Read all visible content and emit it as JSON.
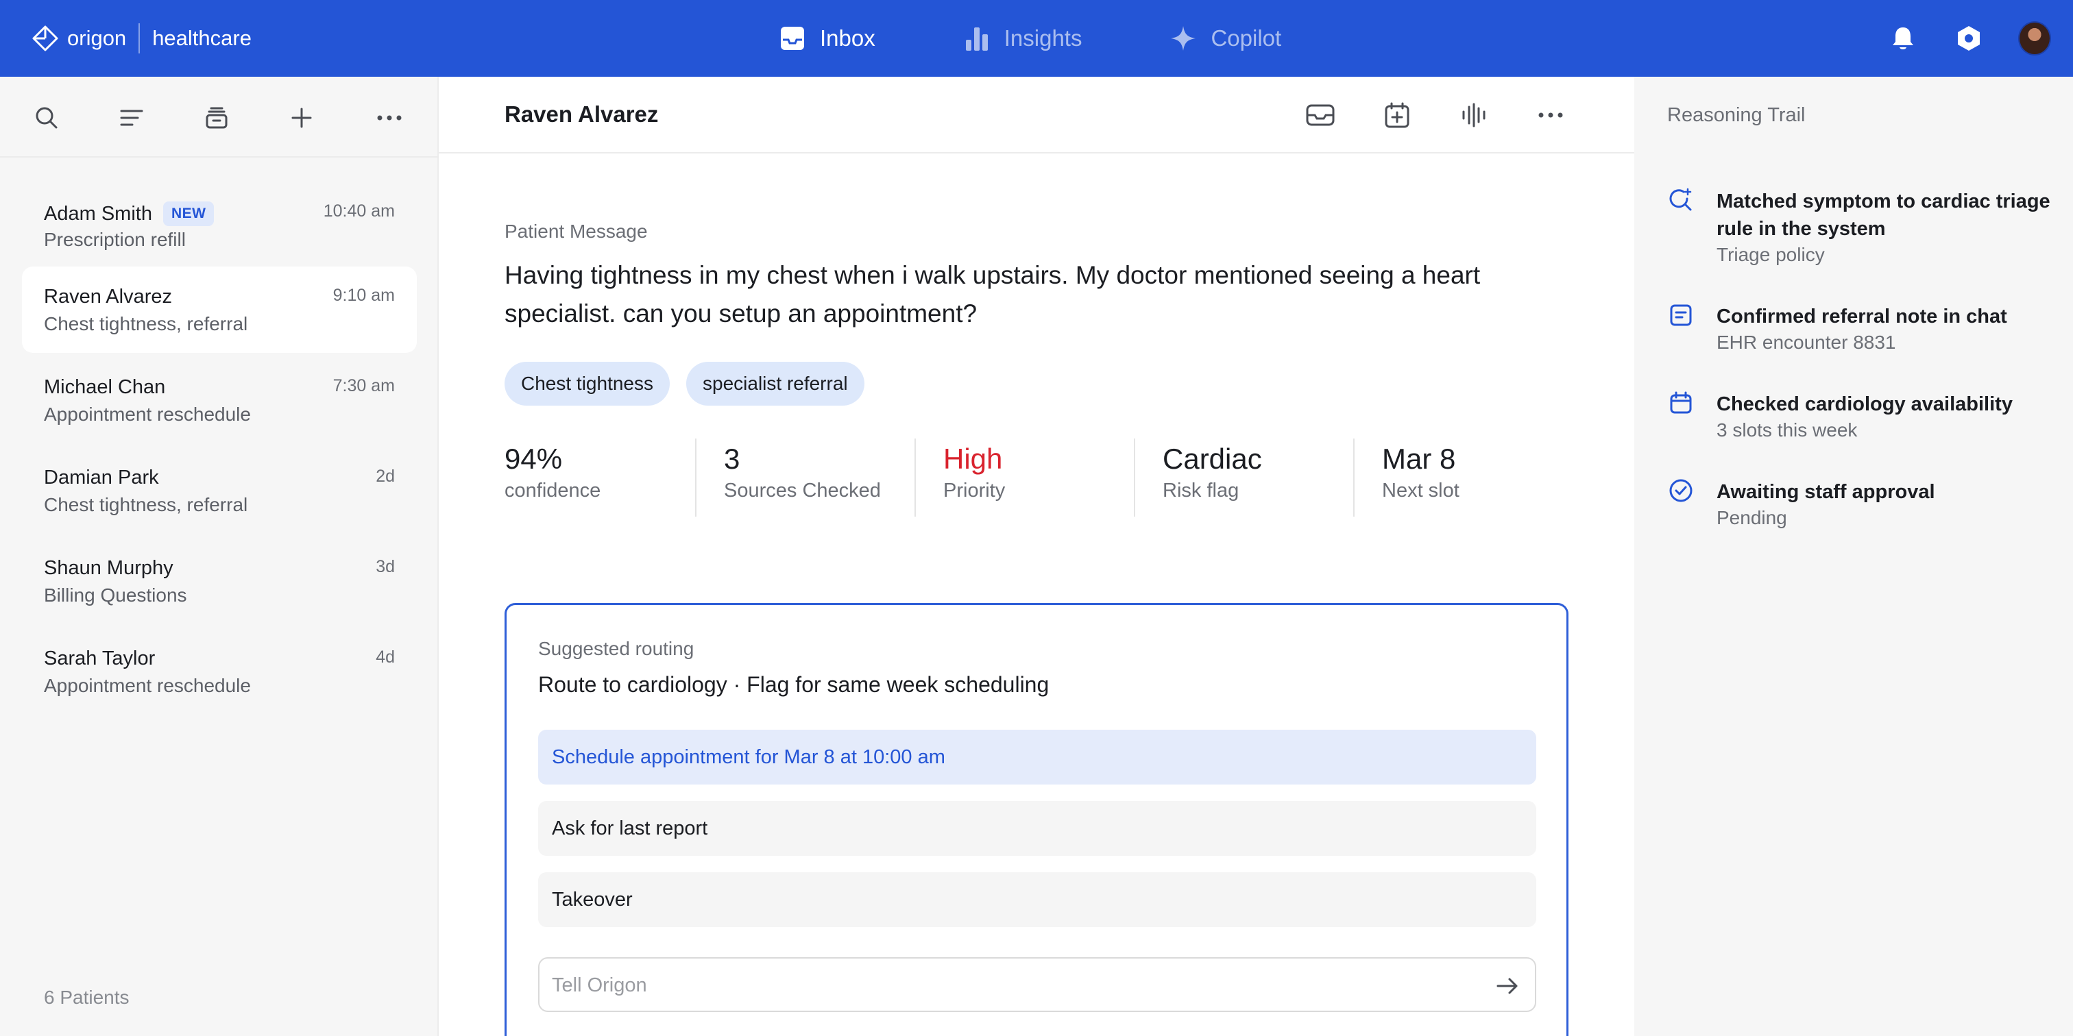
{
  "brand": {
    "name": "origon",
    "product": "healthcare"
  },
  "nav": {
    "items": [
      {
        "label": "Inbox",
        "icon": "inbox-icon",
        "active": true
      },
      {
        "label": "Insights",
        "icon": "bar-chart-icon",
        "active": false
      },
      {
        "label": "Copilot",
        "icon": "sparkle-icon",
        "active": false
      }
    ]
  },
  "topbar_icons": [
    "bell-icon",
    "settings-icon",
    "avatar"
  ],
  "colors": {
    "brand": "#2455d6",
    "accent_light": "#dde8fb",
    "danger": "#d9232e"
  },
  "sidebar": {
    "toolbar_icons": [
      "search-icon",
      "filter-icon",
      "archive-icon",
      "plus-icon",
      "more-icon"
    ],
    "conversations": [
      {
        "name": "Adam Smith",
        "badge": "NEW",
        "subject": "Prescription refill",
        "time": "10:40 am",
        "selected": false
      },
      {
        "name": "Raven Alvarez",
        "subject": "Chest tightness, referral",
        "time": "9:10 am",
        "selected": true
      },
      {
        "name": "Michael Chan",
        "subject": "Appointment reschedule",
        "time": "7:30 am",
        "selected": false
      },
      {
        "name": "Damian Park",
        "subject": "Chest tightness, referral",
        "time": "2d",
        "selected": false
      },
      {
        "name": "Shaun Murphy",
        "subject": "Billing Questions",
        "time": "3d",
        "selected": false
      },
      {
        "name": "Sarah Taylor",
        "subject": "Appointment reschedule",
        "time": "4d",
        "selected": false
      }
    ],
    "footer": "6 Patients"
  },
  "main": {
    "title": "Raven Alvarez",
    "header_icons": [
      "mail-icon",
      "calendar-add-icon",
      "voice-wave-icon",
      "more-icon"
    ],
    "section_label": "Patient Message",
    "message": "Having tightness in my chest when i walk upstairs. My doctor mentioned seeing a heart specialist. can you setup an appointment?",
    "tags": [
      "Chest tightness",
      "specialist referral"
    ],
    "stats": [
      {
        "value": "94%",
        "label": "confidence"
      },
      {
        "value": "3",
        "label": "Sources Checked"
      },
      {
        "value": "High",
        "label": "Priority"
      },
      {
        "value": "Cardiac",
        "label": "Risk flag"
      },
      {
        "value": "Mar 8",
        "label": "Next slot"
      }
    ],
    "routing": {
      "label": "Suggested routing",
      "title": "Route to cardiology · Flag for same week scheduling",
      "options": [
        "Schedule appointment for Mar 8 at 10:00 am",
        "Ask for last report",
        "Takeover"
      ],
      "input_placeholder": "Tell Origon",
      "input_value": ""
    }
  },
  "reasoning": {
    "title": "Reasoning Trail",
    "items": [
      {
        "icon": "search-sparkle-icon",
        "title": "Matched symptom to cardiac triage rule in the system",
        "subtitle": "Triage policy"
      },
      {
        "icon": "note-icon",
        "title": "Confirmed referral note in chat",
        "subtitle": "EHR encounter 8831"
      },
      {
        "icon": "calendar-icon",
        "title": "Checked cardiology availability",
        "subtitle": "3 slots this week"
      },
      {
        "icon": "check-circle-icon",
        "title": "Awaiting staff approval",
        "subtitle": "Pending"
      }
    ]
  }
}
